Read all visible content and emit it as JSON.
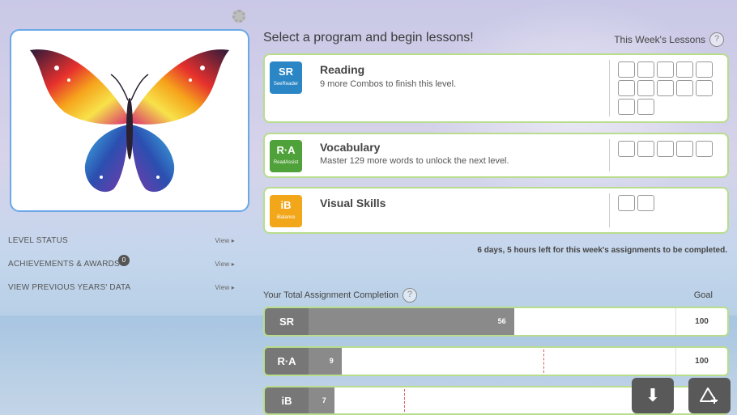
{
  "header": {
    "title": "Select a program and begin lessons!",
    "week_label": "This Week's Lessons",
    "help_symbol": "?"
  },
  "sidebar": {
    "items": [
      {
        "label": "LEVEL STATUS",
        "action": "View ▸"
      },
      {
        "label": "ACHIEVEMENTS & AWARDS",
        "badge": "0",
        "action": "View ▸"
      },
      {
        "label": "VIEW PREVIOUS YEARS' DATA",
        "action": "View ▸"
      }
    ]
  },
  "programs": [
    {
      "logo": "SR",
      "logo_sub": "SeeReader",
      "name": "Reading",
      "desc": "9 more Combos to finish this level.",
      "boxes": 12,
      "color": "#2b86c5"
    },
    {
      "logo": "R·A",
      "logo_sub": "ReadAssist",
      "name": "Vocabulary",
      "desc": "Master 129 more words to unlock the next level.",
      "boxes": 5,
      "color": "#4fa13a"
    },
    {
      "logo": "iB",
      "logo_sub": "iBalance",
      "name": "Visual Skills",
      "desc": "",
      "boxes": 2,
      "color": "#f2a71b"
    }
  ],
  "deadline": "6 days, 5 hours left for this week's assignments to be completed.",
  "completion": {
    "title": "Your Total Assignment Completion",
    "goal_label": "Goal",
    "rows": [
      {
        "logo": "SR",
        "value": "56",
        "fraction": 0.56,
        "marker": null,
        "goal": "100"
      },
      {
        "logo": "R·A",
        "value": "9",
        "fraction": 0.09,
        "marker": 0.64,
        "goal": "100"
      },
      {
        "logo": "iB",
        "value": "7",
        "fraction": 0.07,
        "marker": 0.26,
        "goal": ""
      }
    ]
  },
  "actions": {
    "download_icon": "⬇",
    "share_icon": "triangle-plus-icon"
  }
}
